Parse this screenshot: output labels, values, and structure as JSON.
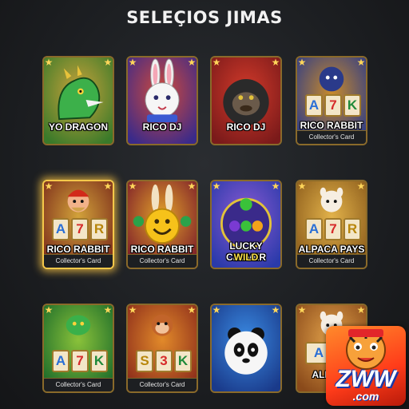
{
  "page": {
    "title": "SELEÇIOS JIMAS"
  },
  "cards": [
    {
      "name": "YO DRAGON",
      "footer": "",
      "art": "dragon",
      "highlight": false,
      "bg": [
        "#3a7a2a",
        "#c9a23a"
      ]
    },
    {
      "name": "RICO DJ",
      "footer": "",
      "art": "rabbit",
      "highlight": false,
      "bg": [
        "#3a2a8a",
        "#d24a3a"
      ]
    },
    {
      "name": "RICO DJ",
      "footer": "",
      "art": "gorilla",
      "highlight": false,
      "bg": [
        "#7a1a1a",
        "#d23a2a"
      ]
    },
    {
      "name": "RICO RABBIT",
      "footer": "Collector's Card",
      "art": "slot-gorilla",
      "reels": [
        "A",
        "7",
        "K"
      ],
      "highlight": false,
      "bg": [
        "#2a3a8a",
        "#c98a2a"
      ]
    },
    {
      "name": "RICO RABBIT",
      "footer": "Collector's Card",
      "art": "slot-dwarf",
      "reels": [
        "A",
        "7",
        "R"
      ],
      "highlight": true,
      "bg": [
        "#7a2a1a",
        "#d2a23a"
      ]
    },
    {
      "name": "RICO RABBIT",
      "footer": "Collector's Card",
      "art": "smiley",
      "highlight": false,
      "bg": [
        "#7a1a2a",
        "#e2a22a"
      ]
    },
    {
      "name": "LUCKY CLOVER",
      "sub": "WILD",
      "footer": "",
      "art": "fruit",
      "highlight": false,
      "bg": [
        "#2a3aaa",
        "#8a5ad2"
      ]
    },
    {
      "name": "ALPACA PAYS",
      "footer": "Collector's Card",
      "art": "slot-alpaca",
      "reels": [
        "A",
        "7",
        "R"
      ],
      "highlight": false,
      "bg": [
        "#8a5a1a",
        "#e2b24a"
      ]
    },
    {
      "name": "",
      "footer": "Collector's Card",
      "art": "slot-dragon",
      "reels": [
        "A",
        "7",
        "K"
      ],
      "highlight": false,
      "bg": [
        "#1a6a2a",
        "#8ac23a"
      ]
    },
    {
      "name": "",
      "footer": "Collector's Card",
      "art": "slot-monkey",
      "reels": [
        "S",
        "3",
        "K"
      ],
      "highlight": false,
      "bg": [
        "#8a2a1a",
        "#e28a2a"
      ]
    },
    {
      "name": "",
      "footer": "",
      "art": "panda",
      "highlight": false,
      "bg": [
        "#1a3a8a",
        "#3a8ae2"
      ]
    },
    {
      "name": "ALPACA",
      "footer": "",
      "art": "slot-alpaca-small",
      "reels": [
        "A",
        "7"
      ],
      "highlight": false,
      "bg": [
        "#8a4a1a",
        "#e2a24a"
      ]
    }
  ],
  "badge": {
    "logo": "ZWW",
    "domain": ".com"
  },
  "icons": {
    "corner": "star-icon"
  }
}
